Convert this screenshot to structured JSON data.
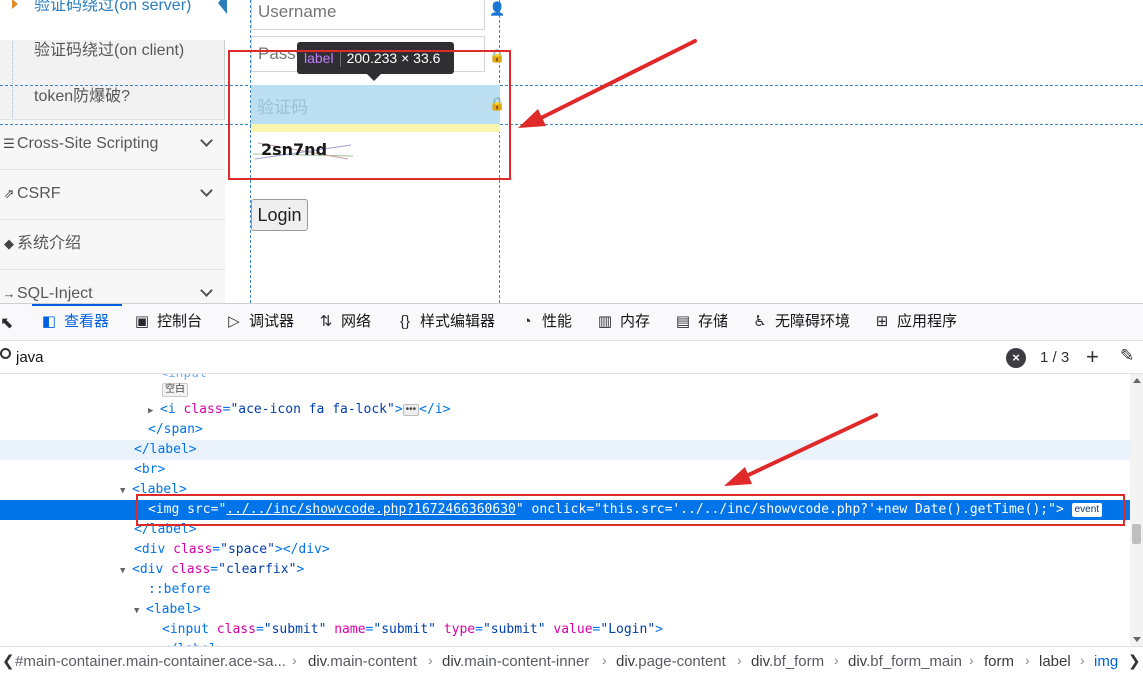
{
  "page": {
    "sidebar": {
      "sub_items": [
        {
          "label": "验证码绕过(on server)",
          "active": true
        },
        {
          "label": "验证码绕过(on client)",
          "active": false
        },
        {
          "label": "token防爆破?",
          "active": false
        }
      ],
      "nav_items": [
        {
          "label": "Cross-Site Scripting",
          "icon": "list-icon"
        },
        {
          "label": "CSRF",
          "icon": "share-icon"
        },
        {
          "label": "系统介绍",
          "icon": "tags-icon"
        },
        {
          "label": "SQL-Inject",
          "icon": "arrow-icon"
        }
      ]
    },
    "form": {
      "username_placeholder": "Username",
      "password_placeholder": "Password",
      "captcha_placeholder": "验证码",
      "captcha_text": "2sn7nd",
      "login_label": "Login"
    },
    "tooltip": {
      "tag": "label",
      "size": "200.233 × 33.6"
    }
  },
  "devtools": {
    "tabs": [
      {
        "label": "查看器",
        "icon": "inspector-icon",
        "selected": true
      },
      {
        "label": "控制台",
        "icon": "console-icon",
        "selected": false
      },
      {
        "label": "调试器",
        "icon": "debugger-icon",
        "selected": false
      },
      {
        "label": "网络",
        "icon": "network-icon",
        "selected": false
      },
      {
        "label": "样式编辑器",
        "icon": "style-editor-icon",
        "selected": false
      },
      {
        "label": "性能",
        "icon": "performance-icon",
        "selected": false
      },
      {
        "label": "内存",
        "icon": "memory-icon",
        "selected": false
      },
      {
        "label": "存储",
        "icon": "storage-icon",
        "selected": false
      },
      {
        "label": "无障碍环境",
        "icon": "accessibility-icon",
        "selected": false
      },
      {
        "label": "应用程序",
        "icon": "application-icon",
        "selected": false
      }
    ],
    "search": {
      "value": "java",
      "match_count": "1 / 3"
    },
    "tree": {
      "space_badge": "空白",
      "i_tag": "i",
      "i_class": "ace-icon fa fa-lock",
      "img_src": "../../inc/showvcode.php?1672466360630",
      "img_onclick": "this.src='../../inc/showvcode.php?'+new Date().getTime();",
      "event_badge": "event",
      "div_space_class": "space",
      "div_clearfix_class": "clearfix",
      "before_pseudo": "::before",
      "input_class": "submit",
      "input_name": "submit",
      "input_type": "submit",
      "input_value": "Login"
    },
    "breadcrumb": [
      {
        "tag": "",
        "cls": "#main-container.main-container.ace-sa...",
        "current": false
      },
      {
        "tag": "div",
        "cls": ".main-content",
        "current": false
      },
      {
        "tag": "div",
        "cls": ".main-content-inner",
        "current": false
      },
      {
        "tag": "div",
        "cls": ".page-content",
        "current": false
      },
      {
        "tag": "div",
        "cls": ".bf_form",
        "current": false
      },
      {
        "tag": "div",
        "cls": ".bf_form_main",
        "current": false
      },
      {
        "tag": "form",
        "cls": "",
        "current": false
      },
      {
        "tag": "label",
        "cls": "",
        "current": false
      },
      {
        "tag": "img",
        "cls": "",
        "current": true
      }
    ]
  }
}
